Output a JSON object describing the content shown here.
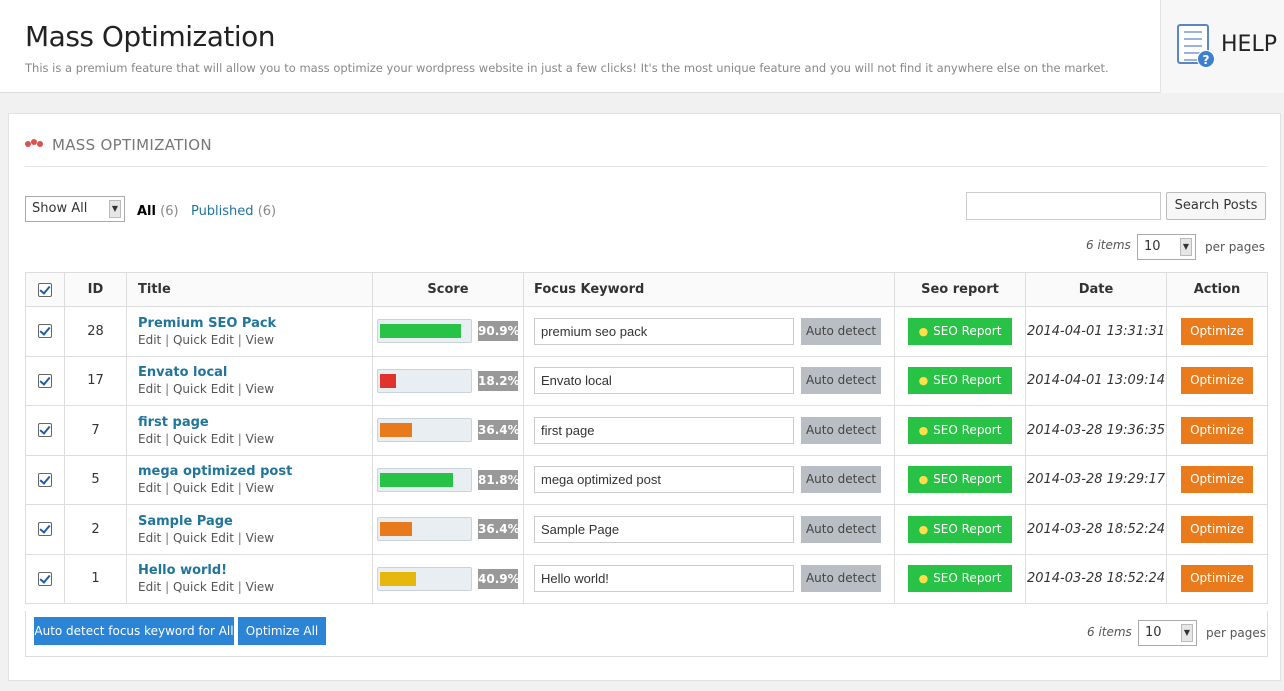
{
  "header": {
    "title": "Mass Optimization",
    "subtitle": "This is a premium feature that will allow you to mass optimize your wordpress website in just a few clicks! It's the most unique feature and you will not find it anywhere else on the market.",
    "help_label": "HELP",
    "help_icon": "help-document-icon"
  },
  "panel": {
    "title": "MASS OPTIMIZATION",
    "icon": "users-icon"
  },
  "filters": {
    "show_select": "Show All",
    "all_label": "All",
    "all_count": "(6)",
    "published_label": "Published",
    "published_count": "(6)"
  },
  "search": {
    "value": "",
    "button_label": "Search Posts"
  },
  "pagination": {
    "items_text": "6 items",
    "per_page_value": "10",
    "per_page_label": "per pages"
  },
  "table": {
    "headers": {
      "id": "ID",
      "title": "Title",
      "score": "Score",
      "keyword": "Focus Keyword",
      "seo": "Seo report",
      "date": "Date",
      "action": "Action"
    },
    "rows": [
      {
        "id": "28",
        "title": "Premium SEO Pack",
        "score": 0.909,
        "score_text": "90.9%",
        "score_color": "#27c246",
        "keyword": "premium seo pack",
        "date": "2014-04-01 13:31:31"
      },
      {
        "id": "17",
        "title": "Envato local",
        "score": 0.182,
        "score_color": "#e0332b",
        "score_text": "18.2%",
        "keyword": "Envato local",
        "date": "2014-04-01 13:09:14"
      },
      {
        "id": "7",
        "title": "first page",
        "score": 0.364,
        "score_text": "36.4%",
        "score_color": "#e87a1c",
        "keyword": "first page",
        "date": "2014-03-28 19:36:35"
      },
      {
        "id": "5",
        "title": "mega optimized post",
        "score": 0.818,
        "score_text": "81.8%",
        "score_color": "#27c246",
        "keyword": "mega optimized post",
        "date": "2014-03-28 19:29:17"
      },
      {
        "id": "2",
        "title": "Sample Page",
        "score": 0.364,
        "score_text": "36.4%",
        "score_color": "#e87a1c",
        "keyword": "Sample Page",
        "date": "2014-03-28 18:52:24"
      },
      {
        "id": "1",
        "title": "Hello world!",
        "score": 0.409,
        "score_text": "40.9%",
        "score_color": "#e6b80e",
        "keyword": "Hello world!",
        "date": "2014-03-28 18:52:24"
      }
    ],
    "row_actions": {
      "edit": "Edit",
      "quick_edit": "Quick Edit",
      "view": "View",
      "separator": "|"
    },
    "auto_detect_label": "Auto detect",
    "seo_report_label": "SEO Report",
    "seo_report_icon": "lightbulb-icon",
    "optimize_label": "Optimize"
  },
  "footer": {
    "auto_detect_all_label": "Auto detect focus keyword for All",
    "optimize_all_label": "Optimize All"
  }
}
